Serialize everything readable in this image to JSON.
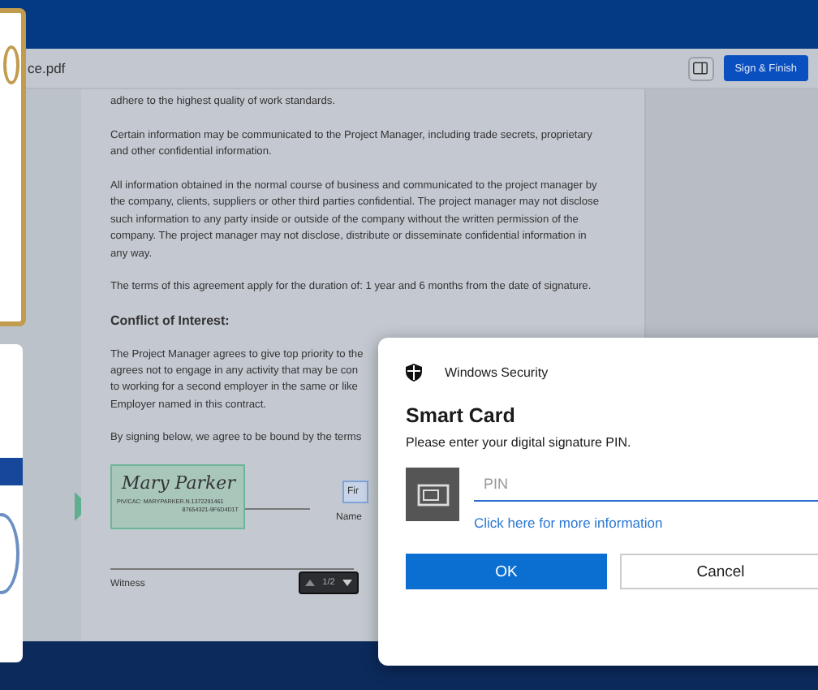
{
  "viewer": {
    "file_name": "ce.pdf",
    "sign_button": "Sign & Finish"
  },
  "document": {
    "paragraphs": [
      {
        "kind": "text",
        "text": "adhere to the highest quality of work standards."
      },
      {
        "kind": "text",
        "text": "Certain information may be communicated to the Project Manager, including trade secrets, proprietary and other confidential information."
      },
      {
        "kind": "text",
        "text": "All information obtained in the normal course of business and communicated to the project manager by the company, clients, suppliers or other third parties confidential. The project manager may not disclose such information to any party inside or outside of the company without the written permission of the company. The project manager may not disclose, distribute or disseminate confidential information in any way."
      },
      {
        "kind": "text",
        "text": "The terms of this agreement apply for the duration of: 1 year and 6 months from the date of signature."
      },
      {
        "kind": "heading",
        "text": "Conflict of Interest:"
      }
    ],
    "covered_lines": [
      [
        "The Project Manager agrees to give top priority to the",
        "agrees not to engage in any activity that may be con",
        "to working for a second employer in the same or like",
        "Employer named in this contract."
      ],
      [
        "By signing below, we agree to be bound by the terms"
      ]
    ],
    "signature": {
      "name": "Mary Parker",
      "line_1": "PIV/CAC: MARYPARKER.N.1372291461",
      "line_2": "87654321-9F6D4D1T"
    },
    "first_name_field": "Fir",
    "name_label": "Name",
    "witness_label": "Witness",
    "page_indicator": "1/2"
  },
  "dialog": {
    "app": "Windows Security",
    "title": "Smart Card",
    "message": "Please enter your digital signature PIN.",
    "pin_placeholder": "PIN",
    "link": "Click here for more information",
    "buttons": [
      {
        "label": "OK",
        "primary": true
      },
      {
        "label": "Cancel",
        "primary": false
      }
    ]
  }
}
